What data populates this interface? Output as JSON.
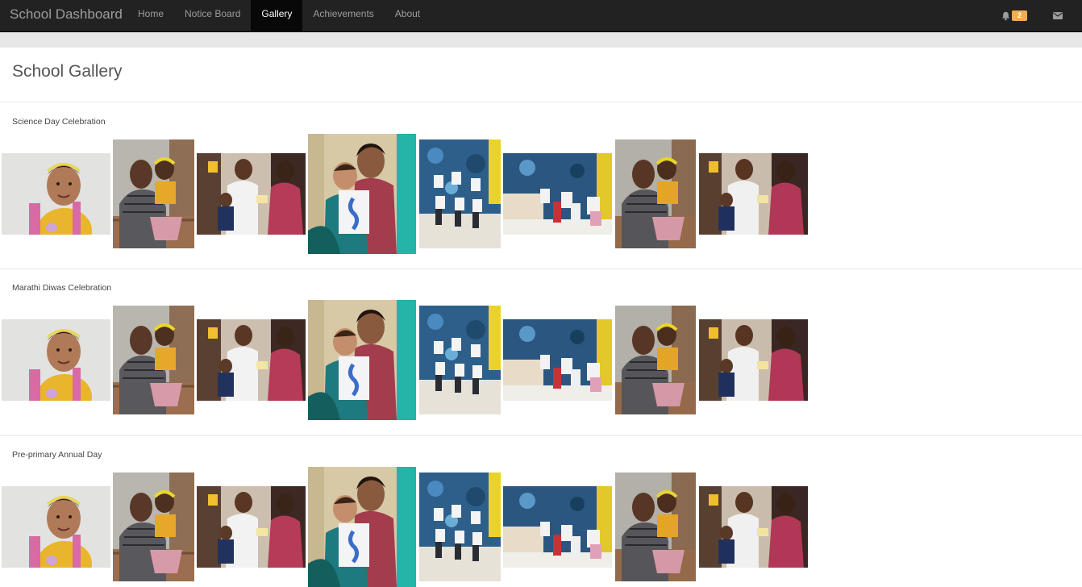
{
  "navbar": {
    "brand": "School Dashboard",
    "items": [
      {
        "label": "Home",
        "active": false
      },
      {
        "label": "Notice Board",
        "active": false
      },
      {
        "label": "Gallery",
        "active": true
      },
      {
        "label": "Achievements",
        "active": false
      },
      {
        "label": "About",
        "active": false
      }
    ],
    "notifications": {
      "icon": "bell-icon",
      "count": "2"
    },
    "messages": {
      "icon": "envelope-icon"
    }
  },
  "page": {
    "title": "School Gallery"
  },
  "gallery": {
    "sections": [
      {
        "title": "Science Day Celebration"
      },
      {
        "title": "Marathi Diwas Celebration"
      },
      {
        "title": "Pre-primary Annual Day"
      }
    ],
    "photos": [
      {
        "name": "girl-yellow-headband"
      },
      {
        "name": "father-with-child"
      },
      {
        "name": "teacher-handing-certificate"
      },
      {
        "name": "child-holding-seahorse-drawing"
      },
      {
        "name": "children-aquarium-wall"
      },
      {
        "name": "children-with-drawings"
      },
      {
        "name": "father-with-child-2"
      },
      {
        "name": "teacher-handing-certificate-2"
      }
    ]
  },
  "colors": {
    "navbar": "#222222",
    "active_tab": "#080808",
    "badge": "#f0ad4e"
  }
}
